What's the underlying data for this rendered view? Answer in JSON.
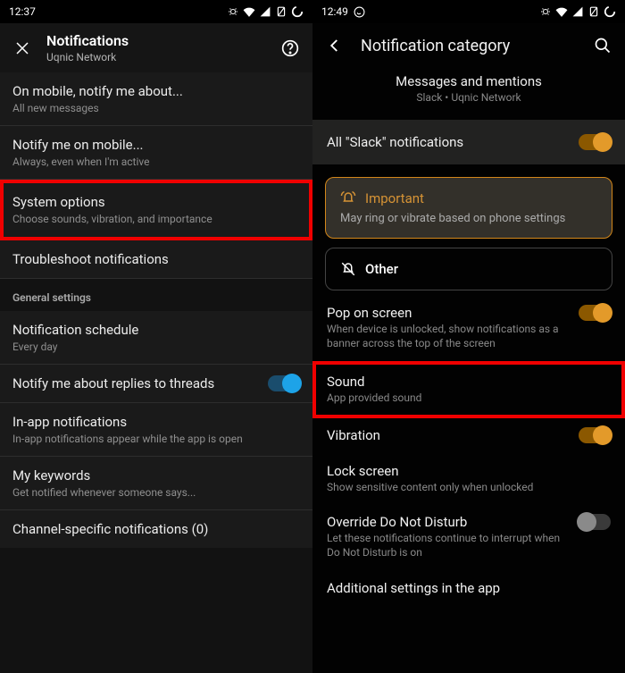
{
  "left": {
    "status": {
      "time": "12:37"
    },
    "header": {
      "title": "Notifications",
      "subtitle": "Uqnic Network"
    },
    "rows": {
      "r1": {
        "title": "On mobile, notify me about...",
        "sub": "All new messages"
      },
      "r2": {
        "title": "Notify me on mobile...",
        "sub": "Always, even when I'm active"
      },
      "r3": {
        "title": "System options",
        "sub": "Choose sounds, vibration, and importance"
      },
      "r4": {
        "title": "Troubleshoot notifications"
      },
      "section": "General settings",
      "r5": {
        "title": "Notification schedule",
        "sub": "Every day"
      },
      "r6": {
        "title": "Notify me about replies to threads"
      },
      "r7": {
        "title": "In-app notifications",
        "sub": "In-app notifications appear while the app is open"
      },
      "r8": {
        "title": "My keywords",
        "sub": "Get notified whenever someone says..."
      },
      "r9": {
        "title": "Channel-specific notifications (0)"
      }
    }
  },
  "right": {
    "status": {
      "time": "12:49"
    },
    "header": {
      "title": "Notification category"
    },
    "sub": {
      "title": "Messages and mentions",
      "line": "Slack • Uqnic Network"
    },
    "allnotif": "All \"Slack\" notifications",
    "important": {
      "label": "Important",
      "desc": "May ring or vibrate based on phone settings"
    },
    "other": {
      "label": "Other"
    },
    "rows": {
      "pop": {
        "title": "Pop on screen",
        "sub": "When device is unlocked, show notifications as a banner across the top of the screen"
      },
      "sound": {
        "title": "Sound",
        "sub": "App provided sound"
      },
      "vibration": {
        "title": "Vibration"
      },
      "lock": {
        "title": "Lock screen",
        "sub": "Show sensitive content only when unlocked"
      },
      "dnd": {
        "title": "Override Do Not Disturb",
        "sub": "Let these notifications continue to interrupt when Do Not Disturb is on"
      },
      "more": {
        "title": "Additional settings in the app"
      }
    }
  }
}
